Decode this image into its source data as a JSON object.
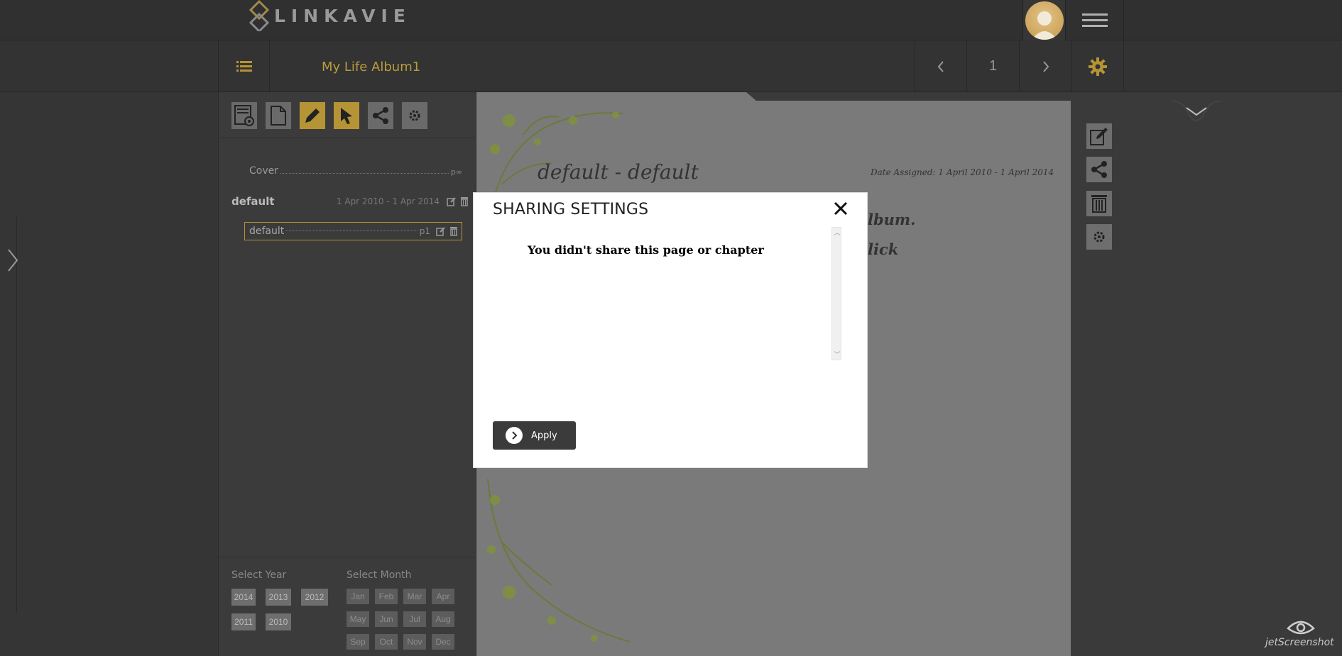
{
  "header": {
    "logo_text": "LINKAVIE",
    "hamburger_icon": "hamburger-menu-icon",
    "avatar_icon": "user-avatar-icon"
  },
  "nav": {
    "album_title": "My Life Album1",
    "page_number": "1",
    "prev_icon": "chevron-left-icon",
    "next_icon": "chevron-right-icon",
    "settings_icon": "gear-icon"
  },
  "sidebar": {
    "cover": {
      "label": "Cover",
      "page": "p∞"
    },
    "chapter": {
      "name": "default",
      "dates": "1 Apr 2010 - 1 Apr 2014"
    },
    "page": {
      "label": "default",
      "page": "p1"
    },
    "select_year_label": "Select Year",
    "select_month_label": "Select Month",
    "years": [
      "2014",
      "2013",
      "2012",
      "2011",
      "2010"
    ],
    "months": [
      "Jan",
      "Feb",
      "Mar",
      "Apr",
      "May",
      "Jun",
      "Jul",
      "Aug",
      "Sep",
      "Oct",
      "Nov",
      "Dec"
    ]
  },
  "canvas": {
    "heading": "default - default",
    "date_assigned": "Date Assigned: 1 April 2010 - 1 April 2014",
    "partial_1": "lbum.",
    "partial_2": "lick"
  },
  "modal": {
    "title": "SHARING SETTINGS",
    "message": "You didn't share this page or chapter",
    "apply_label": "Apply",
    "close_icon": "close-icon"
  },
  "watermark": {
    "text": "jetScreenshot"
  },
  "colors": {
    "accent_gold": "#b59435",
    "header_bg": "#303030",
    "modal_button_bg": "#3b3b3b"
  }
}
